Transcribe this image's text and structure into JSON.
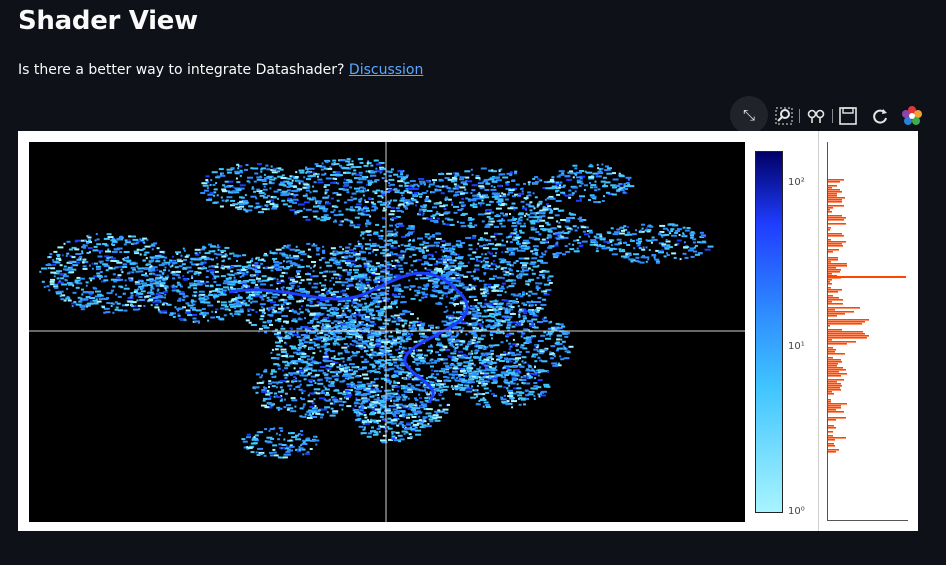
{
  "page": {
    "title": "Shader View",
    "subtitle_text": "Is there a better way to integrate Datashader?",
    "subtitle_link": "Discussion"
  },
  "toolbar": {
    "items": [
      {
        "name": "fullscreen-icon",
        "glyph": "⤡"
      },
      {
        "name": "zoom-icon",
        "glyph": "🔍"
      },
      {
        "name": "box-select-icon",
        "glyph": "⌗"
      },
      {
        "name": "save-icon",
        "glyph": "💾"
      },
      {
        "name": "reset-icon",
        "glyph": "⟳"
      },
      {
        "name": "bokeh-logo-icon",
        "glyph": "✿"
      }
    ]
  },
  "chart_data": [
    {
      "type": "heatmap",
      "title": "",
      "xlabel": "",
      "ylabel": "",
      "colormap": [
        "#a8f4ff",
        "#3fc4ff",
        "#2f8dff",
        "#1f3dff",
        "#000066"
      ],
      "colorbar_scale": "log",
      "colorbar_ticks": [
        "10²",
        "10¹",
        "10⁰"
      ],
      "background": "#000000",
      "crosshair": true
    },
    {
      "type": "bar",
      "orientation": "horizontal",
      "color": "#ff4500",
      "title": "",
      "xlabel": "",
      "ylabel": ""
    }
  ]
}
